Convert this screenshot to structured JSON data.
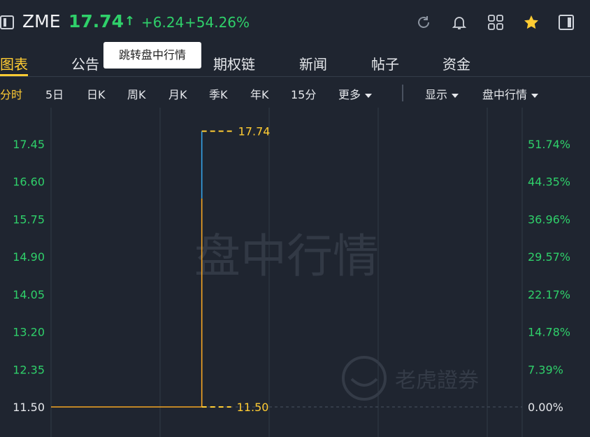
{
  "header": {
    "ticker": "ZME",
    "price": "17.74",
    "arrow": "↑",
    "change": "+6.24",
    "change_pct": "+54.26%"
  },
  "tabs": [
    "图表",
    "公告",
    "期权链",
    "新闻",
    "帖子",
    "资金"
  ],
  "tooltip": "跳转盘中行情",
  "periods": [
    "分时",
    "5日",
    "日K",
    "周K",
    "月K",
    "季K",
    "年K",
    "15分"
  ],
  "more": "更多",
  "display": "显示",
  "session": "盘中行情",
  "watermark": "盘中行情",
  "logo_text": "老虎證券",
  "colors": {
    "up": "#2fd06a",
    "accent": "#ffcc33",
    "line": "#f5a623",
    "line_post": "#35a2e6"
  },
  "chart_data": {
    "type": "line",
    "y_left_ticks": [
      "17.45",
      "16.60",
      "15.75",
      "14.90",
      "14.05",
      "13.20",
      "12.35",
      "11.50"
    ],
    "y_right_ticks": [
      "51.74%",
      "44.35%",
      "36.96%",
      "29.57%",
      "22.17%",
      "14.78%",
      "7.39%",
      "0.00%"
    ],
    "ylim": [
      11.5,
      17.74
    ],
    "prev_close": 11.5,
    "high_label": "17.74",
    "low_label": "11.50",
    "x": [
      0,
      0.32,
      0.32,
      0.32
    ],
    "y": [
      11.5,
      11.5,
      16.22,
      17.74
    ],
    "segment_colors": [
      "line",
      "line",
      "line_post"
    ]
  }
}
